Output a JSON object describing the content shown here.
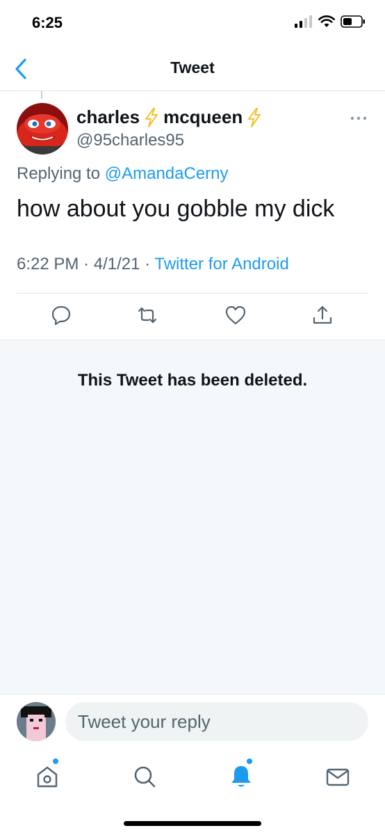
{
  "status_bar": {
    "time": "6:25"
  },
  "nav": {
    "title": "Tweet"
  },
  "tweet": {
    "display_name_first": "charles",
    "display_name_second": "mcqueen",
    "handle": "@95charles95",
    "replying_prefix": "Replying to",
    "replying_to": "@AmandaCerny",
    "text": "how about you gobble my dick",
    "time": "6:22 PM",
    "date": "4/1/21",
    "source": "Twitter for Android"
  },
  "deleted_notice": "This Tweet has been deleted.",
  "reply": {
    "placeholder": "Tweet your reply"
  },
  "colors": {
    "accent": "#1d9bf0",
    "secondary_text": "#536471",
    "lightning": "#f5c12e"
  },
  "icons": [
    "back-icon",
    "more-icon",
    "reply-icon",
    "retweet-icon",
    "like-icon",
    "share-icon",
    "home-icon",
    "search-icon",
    "notifications-icon",
    "messages-icon"
  ]
}
